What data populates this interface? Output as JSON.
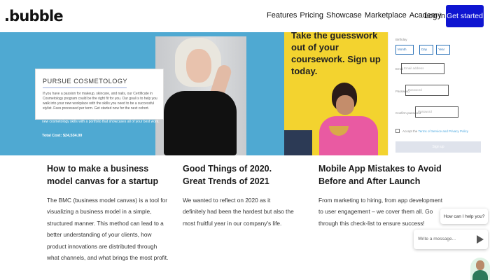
{
  "header": {
    "logo": ".bubble",
    "nav": [
      "Features",
      "Pricing",
      "Showcase",
      "Marketplace",
      "Academy"
    ],
    "login": "Log in",
    "cta": "Get started",
    "cta_color": "#0f15d1"
  },
  "card1": {
    "box_title": "PURSUE COSMETOLOGY",
    "box_text": "If you have a passion for makeup, skincare, and nails, our Certificate in Cosmetology program could be the right fit for you. Our goal is to help you walk into your new workplace with the skills you need to be a successful stylist. Fees processed per term. Get started now for the next cohort.",
    "overflow_text": "new cosmetology skills with a portfolio that showcases all of your best work.",
    "total_cost": "Total Cost: $24,534.00",
    "bg_color": "#4fa9d2"
  },
  "card2": {
    "headline": "Take the guesswork out of your coursework. Sign up today.",
    "bg_color": "#f3d32f"
  },
  "card3": {
    "birth_label": "Birthday",
    "month": "Month",
    "day": "Day",
    "year": "Year",
    "email_label": "Email",
    "email_placeholder": "Email address",
    "password_label": "Password",
    "password_placeholder": "Password",
    "confirm_label": "Confirm password",
    "confirm_placeholder": "Password",
    "agree_prefix": "Accept the",
    "agree_link": "Terms of Service and Privacy Policy",
    "signup": "Sign up"
  },
  "articles": [
    {
      "title": "How to make a business model canvas for a startup",
      "body": "The BMC (business model canvas) is a tool for visualizing a business model in a simple, structured manner. This method can lead to a better understanding of your clients, how product innovations are distributed through what channels, and what brings the most profit."
    },
    {
      "title": "Good Things of 2020. Great Trends of 2021",
      "body": "We wanted to reflect on 2020 as it definitely had been the hardest but also the most fruitful year in our company's life."
    },
    {
      "title": "Mobile App Mistakes to Avoid Before and After Launch",
      "body": "From marketing to hiring, from app development to user engagement – we cover them all. Go through this check-list to ensure success!"
    }
  ],
  "chat": {
    "greeting": "How can I help you?",
    "placeholder": "Write a message..."
  }
}
